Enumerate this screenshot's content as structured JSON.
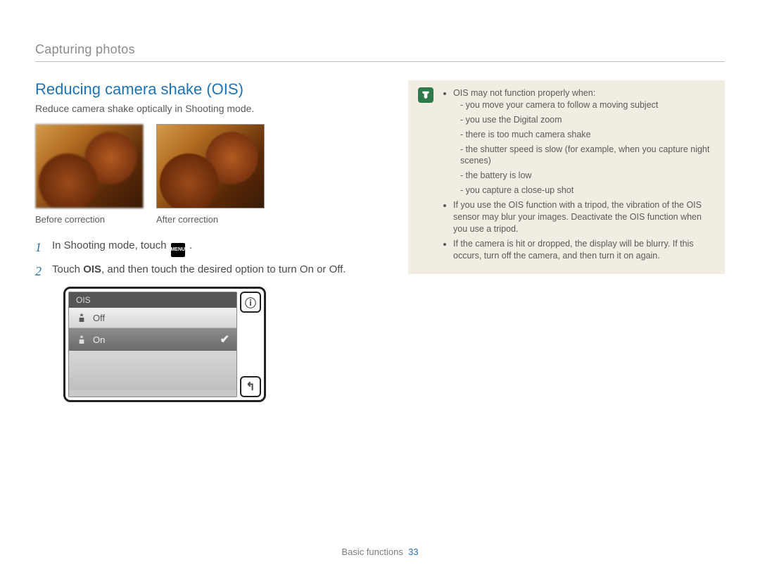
{
  "breadcrumb": "Capturing photos",
  "title": "Reducing camera shake (OIS)",
  "intro": "Reduce camera shake optically in Shooting mode.",
  "captions": {
    "before": "Before correction",
    "after": "After correction"
  },
  "steps": {
    "s1_num": "1",
    "s1_pre": "In Shooting mode, touch ",
    "s1_menu": "MENU",
    "s1_post": " .",
    "s2_num": "2",
    "s2_pre": "Touch ",
    "s2_bold": "OIS",
    "s2_post": ", and then touch the desired option to turn On or Off."
  },
  "ois_panel": {
    "title": "OIS",
    "off": "Off",
    "on": "On",
    "info": "ⓘ",
    "back": "↰"
  },
  "notes": {
    "b1": "OIS may not function properly when:",
    "b1_items": [
      "you move your camera to follow a moving subject",
      "you use the Digital zoom",
      "there is too much camera shake",
      "the shutter speed is slow (for example, when you capture night scenes)",
      "the battery is low",
      "you capture a close-up shot"
    ],
    "b2": "If you use the OIS function with a tripod, the vibration of the OIS sensor may blur your images. Deactivate the OIS function when you use a tripod.",
    "b3": "If the camera is hit or dropped, the display will be blurry. If this occurs, turn off the camera, and then turn it on again."
  },
  "footer": {
    "section": "Basic functions",
    "page": "33"
  }
}
